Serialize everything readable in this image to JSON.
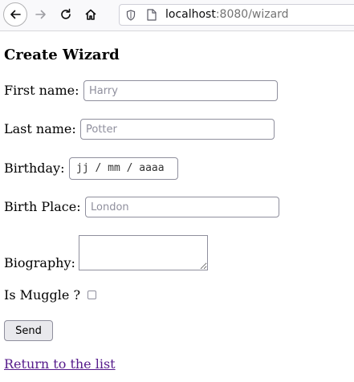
{
  "browser": {
    "url_host": "localhost",
    "url_rest": ":8080/wizard"
  },
  "page": {
    "title": "Create Wizard"
  },
  "form": {
    "first_name": {
      "label": "First name:",
      "placeholder": "Harry",
      "value": ""
    },
    "last_name": {
      "label": "Last name:",
      "placeholder": "Potter",
      "value": ""
    },
    "birthday": {
      "label": "Birthday:",
      "display": "jj / mm / aaaa"
    },
    "birth_place": {
      "label": "Birth Place:",
      "placeholder": "London",
      "value": ""
    },
    "biography": {
      "label": "Biography:",
      "value": ""
    },
    "is_muggle": {
      "label": "Is Muggle ?",
      "checked": false
    },
    "send_label": "Send"
  },
  "return_link": "Return to the list"
}
